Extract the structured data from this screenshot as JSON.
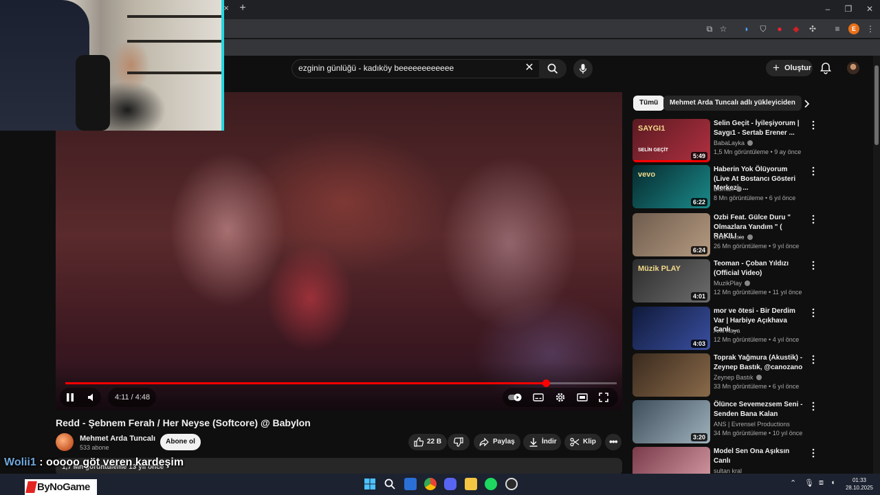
{
  "browser": {
    "window_controls": {
      "minimize": "–",
      "maximize": "❐",
      "close": "✕"
    },
    "tab_close": "×",
    "new_tab": "+",
    "profile_initial": "E"
  },
  "youtube": {
    "search": {
      "value": "ezginin günlüğü - kadıköy beeeeeeeeeeee"
    },
    "create_label": "Oluştur"
  },
  "player": {
    "time": "4:11 / 4:48",
    "progress": 0.872
  },
  "video": {
    "title": "Redd - Şebnem Ferah / Her Neyse (Softcore) @ Babylon",
    "channel": "Mehmet Arda Tuncalı",
    "subscribers": "533 abone",
    "subscribe_label": "Abone ol",
    "likes": "22 B",
    "share_label": "Paylaş",
    "download_label": "İndir",
    "clip_label": "Klip",
    "description_partial": "1,7 Mn görüntüleme  13 yıl önce"
  },
  "chips": [
    "Tümü",
    "Mehmet Arda Tuncalı adlı yükleyiciden"
  ],
  "recommendations": [
    {
      "title": "Selin Geçit - İyileşiyorum | Saygı1 - Sertab Erener ...",
      "channel": "BabaLayka",
      "verified": true,
      "meta": "1,5 Mn görüntüleme • 9 ay önce",
      "duration": "5:49",
      "watched": 1.0,
      "thumb_text": "SAYGI1",
      "thumb_sub": "SELİN GEÇİT",
      "c1": "#5a1a22",
      "c2": "#b13040"
    },
    {
      "title": "Haberin Yok Ölüyorum (Live At Bostancı Gösteri Merkezi, ...",
      "channel": "Duman",
      "verified": true,
      "meta": "8 Mn görüntüleme • 6 yıl önce",
      "duration": "6:22",
      "watched": 0,
      "thumb_text": "vevo",
      "thumb_sub": "",
      "c1": "#062a2e",
      "c2": "#1b8a8a"
    },
    {
      "title": "Ozbi Feat. Gülce Duru \" Olmazlara Yandım \" ( RAKILI ...",
      "channel": "Ozbi Music",
      "verified": true,
      "meta": "26 Mn görüntüleme • 9 yıl önce",
      "duration": "6:24",
      "watched": 0,
      "thumb_text": "",
      "thumb_sub": "",
      "c1": "#6f5c4e",
      "c2": "#b59a80"
    },
    {
      "title": "Teoman - Çoban Yıldızı (Official Video)",
      "channel": "MuzikPlay",
      "verified": true,
      "meta": "12 Mn görüntüleme • 11 yıl önce",
      "duration": "4:01",
      "watched": 0,
      "thumb_text": "Müzik PLAY",
      "thumb_sub": "",
      "c1": "#2c2c2c",
      "c2": "#6d6d6d"
    },
    {
      "title": "mor ve ötesi - Bir Derdim Var | Harbiye Açıkhava Canlı ...",
      "channel": "Anıl Kaya",
      "verified": false,
      "meta": "12 Mn görüntüleme • 4 yıl önce",
      "duration": "4:03",
      "watched": 0,
      "thumb_text": "",
      "thumb_sub": "",
      "c1": "#101a3a",
      "c2": "#3a4fa0"
    },
    {
      "title": "Toprak Yağmura (Akustik) - Zeynep Bastık, @canozano",
      "channel": "Zeynep Bastık",
      "verified": true,
      "meta": "33 Mn görüntüleme • 6 yıl önce",
      "duration": "",
      "watched": 0,
      "thumb_text": "",
      "thumb_sub": "",
      "c1": "#3a2a1e",
      "c2": "#8a6a4a"
    },
    {
      "title": "Ölünce Sevemezsem Seni - Senden Bana Kalan",
      "channel": "ANS | Evrensel Productions",
      "verified": false,
      "meta": "34 Mn görüntüleme • 10 yıl önce",
      "duration": "3:20",
      "watched": 0,
      "thumb_text": "",
      "thumb_sub": "",
      "c1": "#3e4e5a",
      "c2": "#9fb2bc"
    },
    {
      "title": "Model  Sen Ona Aşıksın Canlı",
      "channel": "sultan kral",
      "verified": false,
      "meta": "14 Mn görüntüleme • 11 yıl önce",
      "duration": "",
      "watched": 0,
      "thumb_text": "",
      "thumb_sub": "",
      "c1": "#7a3a4a",
      "c2": "#d8a0a8"
    }
  ],
  "stream": {
    "chat_user": "Wolii1",
    "chat_message": " : ooooo göt veren kardeşim",
    "sponsor": "ByNoGame",
    "webcam_accent": "#23d7e0"
  },
  "taskbar": {
    "time": "01:33",
    "date": "28.10.2025"
  },
  "colors": {
    "accent_red": "#ff0000",
    "background": "#0f0f0f"
  }
}
